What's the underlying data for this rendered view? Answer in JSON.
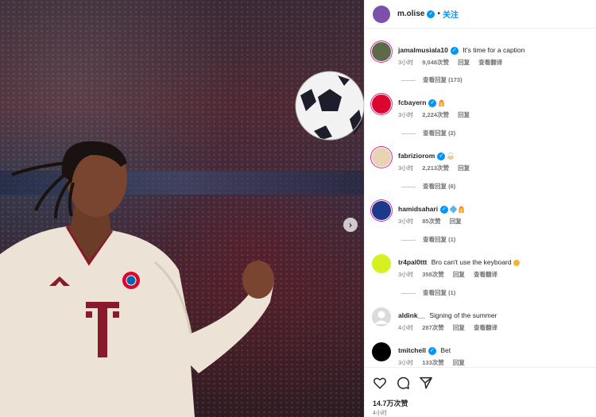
{
  "post": {
    "username": "m.olise",
    "follow_label": "关注",
    "dot": "•",
    "likes": "14.7万次赞",
    "time": "4小时"
  },
  "comments": [
    {
      "username": "jamalmusiala10",
      "text": "It's time for a caption",
      "time": "3小时",
      "likes": "9,048次赞",
      "reply": "回复",
      "translate": "查看翻译",
      "replies": "查看回复 (173)",
      "verified": true,
      "avatar_color": "#5b6b4a",
      "emoji": ""
    },
    {
      "username": "fcbayern",
      "text": "",
      "time": "3小时",
      "likes": "2,224次赞",
      "reply": "回复",
      "translate": "",
      "replies": "查看回复 (2)",
      "verified": true,
      "avatar_color": "#dc052d",
      "emoji": "flame-emoji"
    },
    {
      "username": "fabriziorom",
      "text": "",
      "time": "3小时",
      "likes": "2,213次赞",
      "reply": "回复",
      "translate": "",
      "replies": "查看回复 (6)",
      "verified": true,
      "avatar_color": "#e8d3b4",
      "emoji": "chef-emoji"
    },
    {
      "username": "hamidsahari",
      "text": "",
      "time": "3小时",
      "likes": "85次赞",
      "reply": "回复",
      "translate": "",
      "replies": "查看回复 (1)",
      "verified": true,
      "avatar_color": "#1d3a8a",
      "emoji": "diamond-flame-emoji"
    },
    {
      "username": "tr4pal0ttt",
      "text": "Bro can't use the keyboard",
      "time": "3小时",
      "likes": "358次赞",
      "reply": "回复",
      "translate": "查看翻译",
      "replies": "查看回复 (1)",
      "verified": false,
      "avatar_color": "#d7f021",
      "emoji": "laugh-emoji"
    },
    {
      "username": "aldink__",
      "text": "Signing of the summer",
      "time": "4小时",
      "likes": "287次赞",
      "reply": "回复",
      "translate": "查看翻译",
      "replies": "",
      "verified": false,
      "avatar_color": "#dbdbdb",
      "emoji": ""
    },
    {
      "username": "tmitchell",
      "text": "Bet",
      "time": "3小时",
      "likes": "133次赞",
      "reply": "回复",
      "translate": "",
      "replies": "",
      "verified": true,
      "avatar_color": "#000000",
      "emoji": ""
    }
  ],
  "image": {
    "shirt_logo_letter": "T"
  },
  "colors": {
    "accent": "#0095f6",
    "muted": "#737373",
    "story_ring": "#d6249f",
    "owner_avatar": "#7b52ab"
  }
}
